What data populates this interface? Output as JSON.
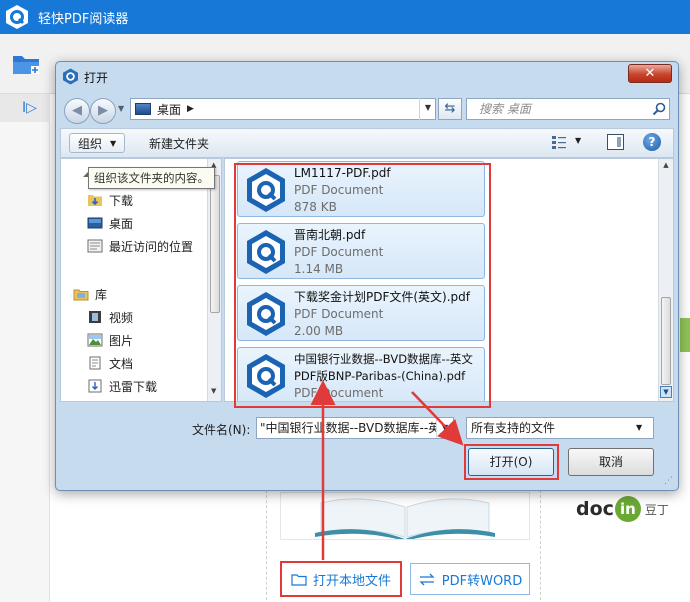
{
  "app": {
    "title": "轻快PDF阅读器",
    "sidebar_toggle_glyph": "I▷",
    "open_local_label": "打开本地文件",
    "pdf_word_label": "PDF转WORD"
  },
  "watermark": {
    "brand": "doc",
    "in": "in",
    "cn": "豆丁"
  },
  "dialog": {
    "title": "打开",
    "close_glyph": "✕",
    "address": {
      "location": "桌面",
      "separator": "▶"
    },
    "search_placeholder": "搜索 桌面",
    "toolbar": {
      "organize_label": "组织",
      "new_folder_label": "新建文件夹",
      "help_glyph": "?"
    },
    "tooltip": "组织该文件夹的内容。",
    "nav_items": [
      {
        "label": "下载",
        "icon": "download-folder-icon"
      },
      {
        "label": "桌面",
        "icon": "desktop-icon"
      },
      {
        "label": "最近访问的位置",
        "icon": "recent-places-icon"
      },
      {
        "label": "库",
        "icon": "library-icon"
      },
      {
        "label": "视频",
        "icon": "video-library-icon"
      },
      {
        "label": "图片",
        "icon": "picture-library-icon"
      },
      {
        "label": "文档",
        "icon": "document-library-icon"
      },
      {
        "label": "迅雷下载",
        "icon": "thunder-download-icon"
      }
    ],
    "files": [
      {
        "name": "LM1117-PDF.pdf",
        "type": "PDF Document",
        "size": "878 KB"
      },
      {
        "name": "晋南北朝.pdf",
        "type": "PDF Document",
        "size": "1.14 MB"
      },
      {
        "name": "下载奖金计划PDF文件(英文).pdf",
        "type": "PDF Document",
        "size": "2.00 MB"
      },
      {
        "name": "中国银行业数据--BVD数据库--英文PDF版BNP-Paribas-(China).pdf",
        "type": "PDF Document",
        "size": ""
      }
    ],
    "filename_label": "文件名(N):",
    "filename_value": "\"中国银行业数据--BVD数据库--英",
    "filter_value": "所有支持的文件",
    "open_label": "打开(O)",
    "cancel_label": "取消"
  },
  "colors": {
    "app_blue": "#1778d8",
    "highlight_red": "#e03a3a",
    "dialog_frame": "#c7dbef"
  }
}
